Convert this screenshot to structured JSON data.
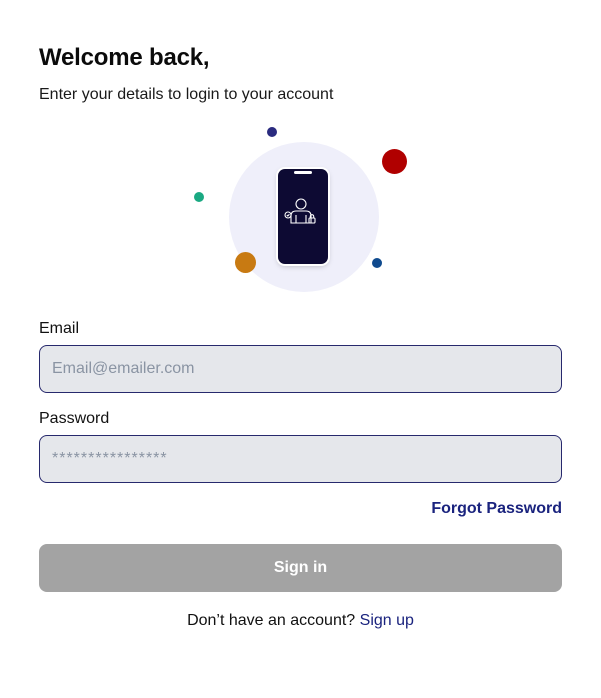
{
  "header": {
    "title": "Welcome back,",
    "subtitle": "Enter your details to login to your account"
  },
  "illustration": {
    "icon": "phone-user-lock-icon",
    "colors": {
      "halo": "#efeffa",
      "phone": "#0d0a33",
      "dot_navy": "#2a2b7f",
      "dot_red": "#b00000",
      "dot_green": "#1aa982",
      "dot_orange": "#c87a12",
      "dot_blue": "#0f4a8e"
    }
  },
  "form": {
    "email": {
      "label": "Email",
      "placeholder": "Email@emailer.com",
      "value": ""
    },
    "password": {
      "label": "Password",
      "placeholder": "****************",
      "value": ""
    },
    "forgot_password": "Forgot Password",
    "submit_label": "Sign in"
  },
  "footer": {
    "prompt": "Don’t have an account?",
    "signup_label": "Sign up"
  },
  "colors": {
    "accent": "#1a237e",
    "input_border": "#27296d",
    "input_bg": "#e5e7eb",
    "button_disabled": "#a3a3a3"
  }
}
